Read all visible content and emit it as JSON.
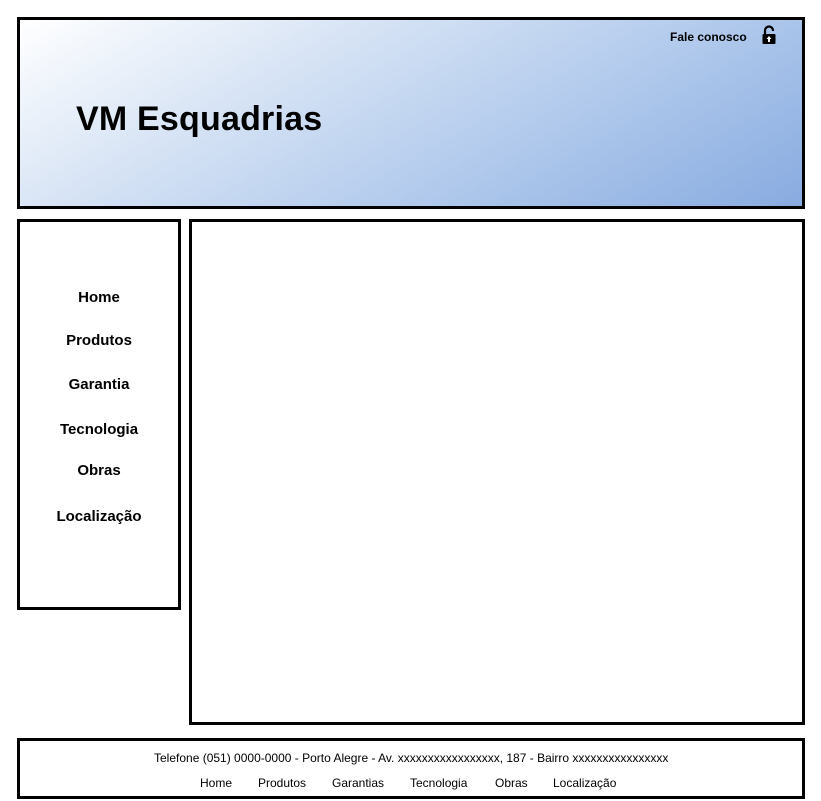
{
  "header": {
    "title": "VM Esquadrias",
    "contact_label": "Fale conosco",
    "lock_icon": "unlocked-padlock-icon"
  },
  "sidebar": {
    "items": [
      {
        "label": "Home"
      },
      {
        "label": "Produtos"
      },
      {
        "label": "Garantia"
      },
      {
        "label": "Tecnologia"
      },
      {
        "label": "Obras"
      },
      {
        "label": "Localização"
      }
    ]
  },
  "footer": {
    "address": "Telefone (051) 0000-0000 - Porto Alegre - Av. xxxxxxxxxxxxxxxxx, 187 - Bairro xxxxxxxxxxxxxxxx",
    "links": [
      {
        "label": "Home"
      },
      {
        "label": "Produtos"
      },
      {
        "label": "Garantias"
      },
      {
        "label": "Tecnologia"
      },
      {
        "label": "Obras"
      },
      {
        "label": "Localização"
      }
    ]
  },
  "colors": {
    "border": "#000000",
    "header_gradient_start": "#ffffff",
    "header_gradient_end": "#88abe0"
  }
}
